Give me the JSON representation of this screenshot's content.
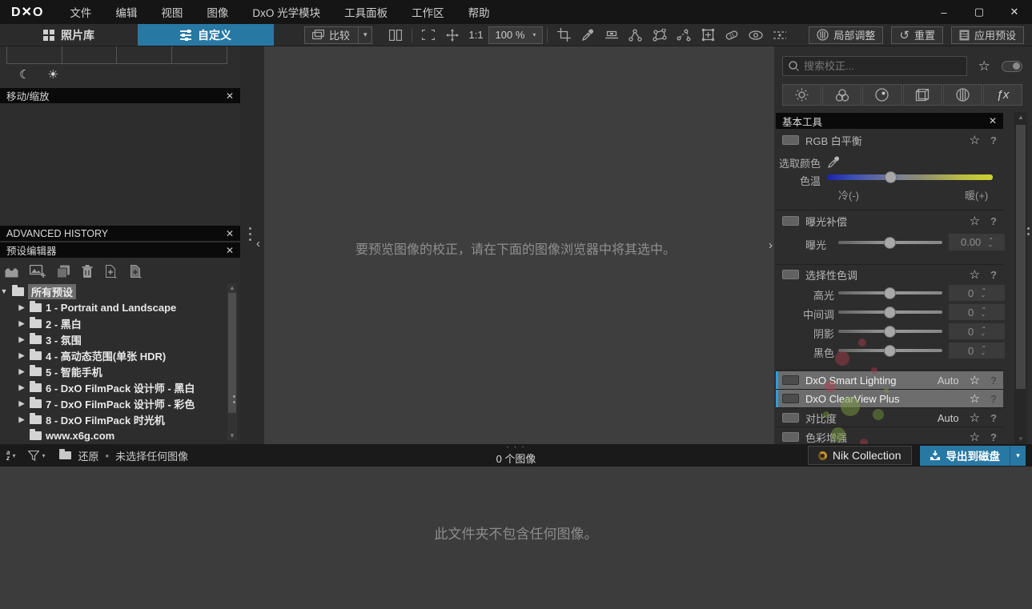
{
  "titlebar": {
    "logo": "D✕O",
    "menus": [
      "文件",
      "编辑",
      "视图",
      "图像",
      "DxO 光学模块",
      "工具面板",
      "工作区",
      "帮助"
    ],
    "controls": {
      "minimize": "–",
      "maximize": "▢",
      "close": "✕"
    }
  },
  "mode_tabs": {
    "library": "照片库",
    "customize": "自定义"
  },
  "toolbar": {
    "compare": "比较",
    "one_to_one": "1:1",
    "zoom_value": "100 %",
    "local_adjustments": "局部调整",
    "reset": "重置",
    "apply_preset": "应用预设"
  },
  "left_panel": {
    "pan_zoom_title": "移动/缩放",
    "advanced_history_title": "ADVANCED HISTORY",
    "preset_editor_title": "预设编辑器",
    "tree": [
      {
        "label": "所有预设"
      },
      {
        "label": "1 - Portrait and Landscape"
      },
      {
        "label": "2 - 黑白"
      },
      {
        "label": "3 - 氛围"
      },
      {
        "label": "4 - 高动态范围(单张 HDR)"
      },
      {
        "label": "5 - 智能手机"
      },
      {
        "label": "6 - DxO FilmPack 设计师 - 黑白"
      },
      {
        "label": "7 - DxO FilmPack 设计师 - 彩色"
      },
      {
        "label": "8 - DxO FilmPack 时光机"
      },
      {
        "label": "www.x6g.com"
      }
    ]
  },
  "viewer": {
    "hint": "要预览图像的校正，请在下面的图像浏览器中将其选中。"
  },
  "right_panel": {
    "search_placeholder": "搜索校正...",
    "group_title": "基本工具",
    "white_balance": {
      "title": "RGB 白平衡",
      "pick_color": "选取颜色",
      "temperature": "色温",
      "cold": "冷(-)",
      "warm": "暖(+)"
    },
    "exposure": {
      "title": "曝光补偿",
      "label": "曝光",
      "value": "0.00"
    },
    "selective_tone": {
      "title": "选择性色调",
      "rows": [
        {
          "label": "高光",
          "value": "0"
        },
        {
          "label": "中间调",
          "value": "0"
        },
        {
          "label": "阴影",
          "value": "0"
        },
        {
          "label": "黑色",
          "value": "0"
        }
      ]
    },
    "tools": [
      {
        "label": "DxO Smart Lighting",
        "badge": "Auto"
      },
      {
        "label": "DxO ClearView Plus",
        "badge": ""
      },
      {
        "label": "对比度",
        "badge": "Auto"
      },
      {
        "label": "色彩增强",
        "badge": ""
      }
    ],
    "fx_label": "ƒx"
  },
  "status_bar": {
    "restore": "还原",
    "selection": "未选择任何图像",
    "image_count": "0 个图像",
    "nik": "Nik Collection",
    "export": "导出到磁盘"
  },
  "browser": {
    "empty": "此文件夹不包含任何图像。"
  },
  "glyphs": {
    "close": "✕",
    "star": "☆",
    "help": "?",
    "moon": "☾",
    "sun": "☀",
    "tri_down": "▼",
    "tri_right": "▶",
    "chev_left": "‹",
    "chev_right": "›",
    "dropdown": "▾",
    "spin_up": "⌃",
    "spin_down": "⌄",
    "bullet": "•",
    "grip": "· · ·",
    "arrow_up": "▲",
    "arrow_down": "▼",
    "a": "a",
    "z": "z",
    "reset_arrow": "↺"
  },
  "colors": {
    "accent_blue": "#2878a4",
    "highlight_bar": "#2e9ce0",
    "highlight_row": "#6d6d6d"
  }
}
